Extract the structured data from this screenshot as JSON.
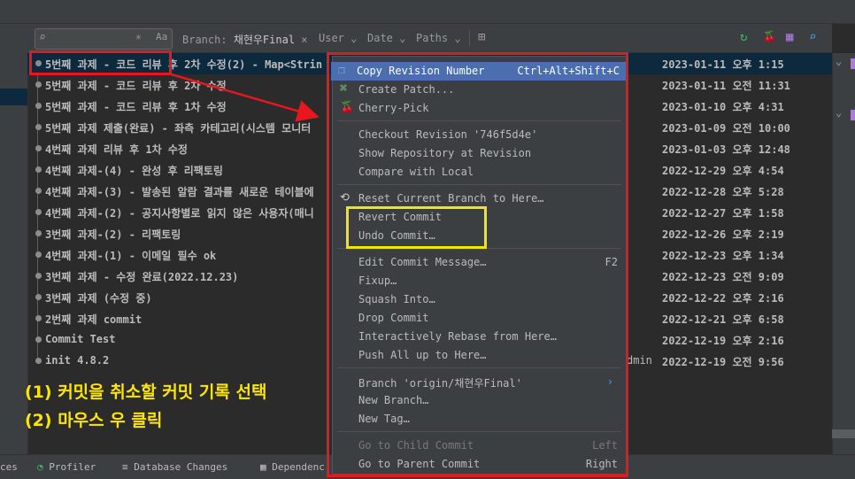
{
  "toolbar": {
    "search_icon": "search-icon",
    "regex_glyph": "✳",
    "case_glyph": "Aa",
    "branch_label": "Branch:",
    "branch_value": "채현우Final",
    "branch_clear": "×",
    "user_label": "User",
    "date_label": "Date",
    "paths_label": "Paths",
    "chevron": "⌄",
    "new_tab_glyph": "⊞",
    "refresh_glyph": "↻",
    "cherry_glyph": "🍒",
    "grid_glyph": "▦",
    "find_glyph": "⌕"
  },
  "commits": [
    {
      "subject": "5번째 과제 - 코드 리뷰 후 2차 수정(2) - Map<Strin",
      "author": "",
      "date": "2023-01-11 오후 1:15"
    },
    {
      "subject": "5번째 과제 - 코드 리뷰 후 2차 수정",
      "author": "",
      "date": "2023-01-11 오전 11:31"
    },
    {
      "subject": "5번째 과제 - 코드 리뷰 후 1차 수정",
      "author": "",
      "date": "2023-01-10 오후 4:31"
    },
    {
      "subject": "5번째 과제 제출(완료) - 좌측 카테고리(시스템 모니터",
      "author": "",
      "date": "2023-01-09 오전 10:00"
    },
    {
      "subject": "4번째 과제 리뷰 후 1차 수정",
      "author": "",
      "date": "2023-01-03 오후 12:48"
    },
    {
      "subject": "4번째 과제-(4) - 완성 후 리팩토링",
      "author": "",
      "date": "2022-12-29 오후 4:54"
    },
    {
      "subject": "4번째 과제-(3) - 발송된 알람 결과를 새로운 테이블에",
      "author": "",
      "date": "2022-12-28 오후 5:28"
    },
    {
      "subject": "4번째 과제-(2) - 공지사항별로 읽지 않은 사용자(매니",
      "author": "",
      "date": "2022-12-27 오후 1:58"
    },
    {
      "subject": "3번째 과제-(2) - 리팩토링",
      "author": "",
      "date": "2022-12-26 오후 2:19"
    },
    {
      "subject": "4번째 과제-(1) - 이메일 필수 ok",
      "author": "",
      "date": "2022-12-23 오후 1:34"
    },
    {
      "subject": "3번째 과제 - 수정 완료(2022.12.23)",
      "author": "",
      "date": "2022-12-23 오전 9:09"
    },
    {
      "subject": "3번째 과제 (수정 중)",
      "author": "",
      "date": "2022-12-22 오후 2:16"
    },
    {
      "subject": "2번째 과제 commit",
      "author": "",
      "date": "2022-12-21 오후 6:58"
    },
    {
      "subject": "Commit Test",
      "author": "",
      "date": "2022-12-19 오후 2:16"
    },
    {
      "subject": "init 4.8.2",
      "author": "dmin",
      "date": "2022-12-19 오전 9:56"
    }
  ],
  "menu": {
    "items": [
      {
        "label": "Copy Revision Number",
        "shortcut": "Ctrl+Alt+Shift+C",
        "icon": "copy-icon",
        "glyph": "❐",
        "highlighted": true
      },
      {
        "label": "Create Patch...",
        "shortcut": "",
        "icon": "patch-icon",
        "glyph": "⌘"
      },
      {
        "label": "Cherry-Pick",
        "shortcut": "",
        "icon": "cherry-icon",
        "glyph": "🍒"
      },
      {
        "label": "Checkout Revision '746f5d4e'",
        "shortcut": ""
      },
      {
        "label": "Show Repository at Revision",
        "shortcut": ""
      },
      {
        "label": "Compare with Local",
        "shortcut": ""
      },
      {
        "label": "Reset Current Branch to Here…",
        "shortcut": "",
        "icon": "reset-icon",
        "glyph": "⟲"
      },
      {
        "label": "Revert Commit",
        "shortcut": ""
      },
      {
        "label": "Undo Commit…",
        "shortcut": ""
      },
      {
        "label": "Edit Commit Message…",
        "shortcut": "F2"
      },
      {
        "label": "Fixup…",
        "shortcut": ""
      },
      {
        "label": "Squash Into…",
        "shortcut": ""
      },
      {
        "label": "Drop Commit",
        "shortcut": ""
      },
      {
        "label": "Interactively Rebase from Here…",
        "shortcut": ""
      },
      {
        "label": "Push All up to Here…",
        "shortcut": ""
      },
      {
        "label": "Branch 'origin/채현우Final'",
        "shortcut": "›"
      },
      {
        "label": "New Branch…",
        "shortcut": ""
      },
      {
        "label": "New Tag…",
        "shortcut": ""
      },
      {
        "label": "Go to Child Commit",
        "shortcut": "Left",
        "disabled": true
      },
      {
        "label": "Go to Parent Commit",
        "shortcut": "Right"
      }
    ]
  },
  "annotations": {
    "line1": "(1) 커밋을 취소할 커밋 기록 선택",
    "line2": "(2) 마우스 우 클릭"
  },
  "statusbar": {
    "item_ces": "ces",
    "profiler": "Profiler",
    "database_changes": "Database Changes",
    "dependencies": "Dependenc"
  },
  "colors": {
    "highlight": "#4b6eaf",
    "annotation_red": "#e8161d",
    "annotation_yellow": "#f5e600",
    "annotation_text": "#ffe600",
    "refresh_green": "#3db86b",
    "purple": "#b07ad7",
    "blue": "#4a9ff0"
  }
}
